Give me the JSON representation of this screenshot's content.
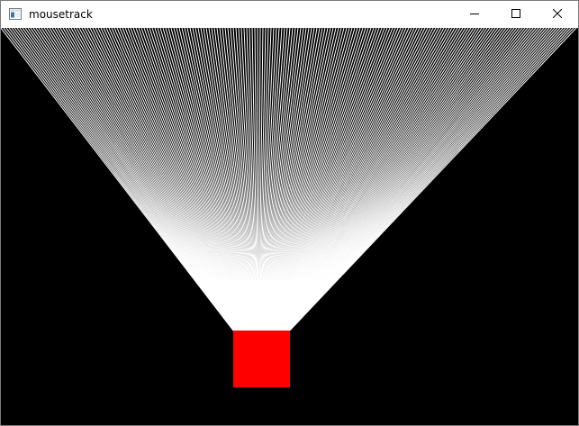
{
  "window": {
    "title": "mousetrack",
    "icons": {
      "app": "window-app-icon",
      "minimize": "minimize-icon",
      "maximize": "maximize-icon",
      "close": "close-icon"
    }
  },
  "scene": {
    "background_color": "#000000",
    "line_color": "#ffffff",
    "cursor_box_color": "#ff0000"
  }
}
